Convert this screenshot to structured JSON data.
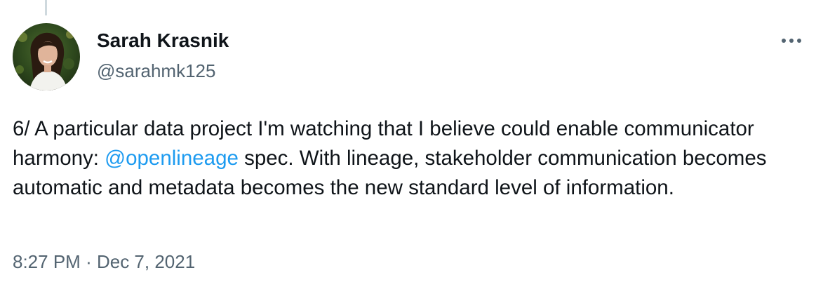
{
  "author": {
    "display_name": "Sarah Krasnik",
    "handle": "@sarahmk125",
    "avatar_icon": "profile-photo"
  },
  "menu": {
    "icon": "more-horizontal-icon"
  },
  "tweet": {
    "text_before_mention": "6/ A particular data project I'm watching that I believe could enable communicator harmony: ",
    "mention": "@openlineage",
    "text_after_mention": " spec. With lineage, stakeholder communication becomes automatic and metadata becomes the new standard level of information."
  },
  "meta": {
    "time": "8:27 PM",
    "separator": "·",
    "date": "Dec 7, 2021"
  },
  "colors": {
    "link": "#1d9bf0",
    "secondary_text": "#536471",
    "primary_text": "#0f1419",
    "thread_line": "#cfd9de"
  }
}
